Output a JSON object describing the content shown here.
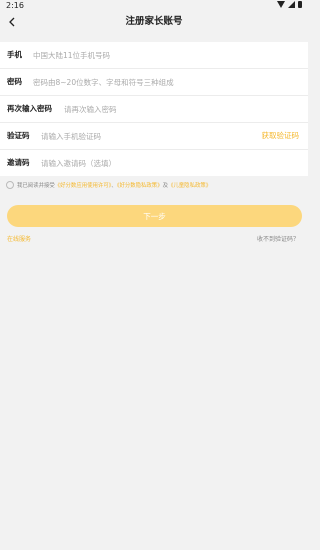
{
  "status_bar": {
    "time": "2:16"
  },
  "header": {
    "title": "注册家长账号"
  },
  "form": {
    "fields": [
      {
        "label": "手机",
        "placeholder": "中国大陆11位手机号码"
      },
      {
        "label": "密码",
        "placeholder": "密码由8~20位数字、字母和符号三种组成"
      },
      {
        "label": "再次输入密码",
        "placeholder": "请再次输入密码"
      },
      {
        "label": "验证码",
        "placeholder": "请输入手机验证码",
        "action": "获取验证码"
      },
      {
        "label": "邀请码",
        "placeholder": "请输入邀请码（选填）"
      }
    ]
  },
  "agreement": {
    "prefix": "我已阅读并接受",
    "link1": "《好分数应用使用许可》",
    "sep": "、",
    "link2": "《好分数隐私政策》",
    "and": "及",
    "link3": "《儿童隐私政策》"
  },
  "next_button": "下一步",
  "footer": {
    "online_service": "在线服务",
    "no_code": "收不到验证码？"
  },
  "colors": {
    "accent": "#f5b82e",
    "button": "#fcd77d",
    "background": "#f2f2f2"
  }
}
